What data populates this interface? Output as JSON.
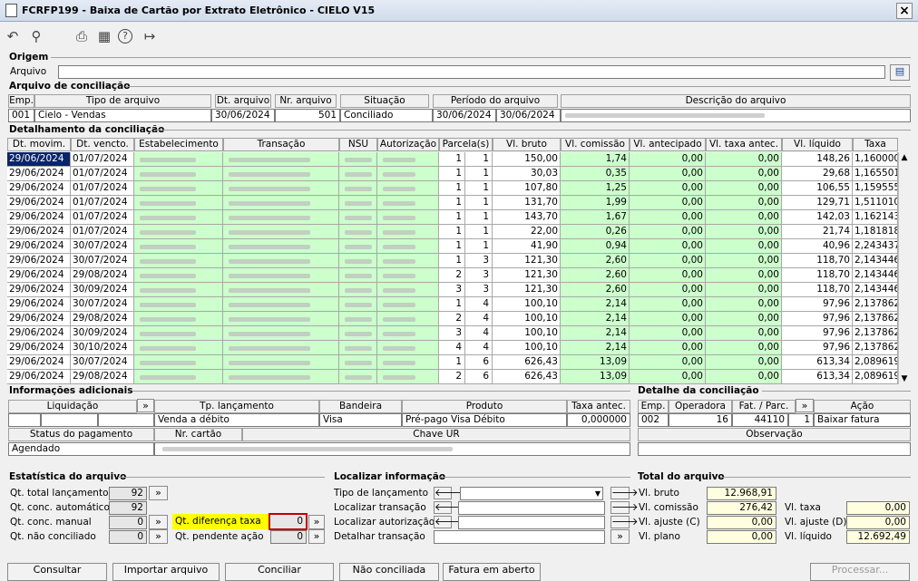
{
  "window": {
    "title": "FCRFP199 - Baixa de Cartão por Extrato Eletrônico - CIELO V15",
    "close": "×"
  },
  "toolbar": {
    "undo": "↶",
    "search": "⚲",
    "print": "⎙",
    "calendar": "▦",
    "help": "?",
    "exit": "↦"
  },
  "origem": {
    "section": "Origem",
    "arquivo_label": "Arquivo",
    "arquivo_value": ""
  },
  "conciliacao": {
    "section": "Arquivo de conciliação",
    "headers": [
      "Emp.",
      "Tipo de arquivo",
      "Dt. arquivo",
      "Nr. arquivo",
      "Situação",
      "Período do arquivo",
      "Descrição do arquivo"
    ],
    "row": {
      "emp": "001",
      "tipo": "Cielo - Vendas",
      "dt": "30/06/2024",
      "nr": "501",
      "situacao": "Conciliado",
      "periodo_ini": "30/06/2024",
      "periodo_fim": "30/06/2024"
    }
  },
  "detalhamento": {
    "section": "Detalhamento da conciliação",
    "headers": [
      "Dt. movim.",
      "Dt. vencto.",
      "Estabelecimento",
      "Transação",
      "NSU",
      "Autorização",
      "Parcela(s)",
      "Vl. bruto",
      "Vl. comissão",
      "Vl. antecipado",
      "Vl. taxa antec.",
      "Vl. líquido",
      "Taxa"
    ],
    "rows": [
      [
        "29/06/2024",
        "01/07/2024",
        "1",
        "1",
        "150,00",
        "1,74",
        "0,00",
        "0,00",
        "148,26",
        "1,160000"
      ],
      [
        "29/06/2024",
        "01/07/2024",
        "1",
        "1",
        "30,03",
        "0,35",
        "0,00",
        "0,00",
        "29,68",
        "1,165501"
      ],
      [
        "29/06/2024",
        "01/07/2024",
        "1",
        "1",
        "107,80",
        "1,25",
        "0,00",
        "0,00",
        "106,55",
        "1,159555"
      ],
      [
        "29/06/2024",
        "01/07/2024",
        "1",
        "1",
        "131,70",
        "1,99",
        "0,00",
        "0,00",
        "129,71",
        "1,511010"
      ],
      [
        "29/06/2024",
        "01/07/2024",
        "1",
        "1",
        "143,70",
        "1,67",
        "0,00",
        "0,00",
        "142,03",
        "1,162143"
      ],
      [
        "29/06/2024",
        "01/07/2024",
        "1",
        "1",
        "22,00",
        "0,26",
        "0,00",
        "0,00",
        "21,74",
        "1,181818"
      ],
      [
        "29/06/2024",
        "30/07/2024",
        "1",
        "1",
        "41,90",
        "0,94",
        "0,00",
        "0,00",
        "40,96",
        "2,243437"
      ],
      [
        "29/06/2024",
        "30/07/2024",
        "1",
        "3",
        "121,30",
        "2,60",
        "0,00",
        "0,00",
        "118,70",
        "2,143446"
      ],
      [
        "29/06/2024",
        "29/08/2024",
        "2",
        "3",
        "121,30",
        "2,60",
        "0,00",
        "0,00",
        "118,70",
        "2,143446"
      ],
      [
        "29/06/2024",
        "30/09/2024",
        "3",
        "3",
        "121,30",
        "2,60",
        "0,00",
        "0,00",
        "118,70",
        "2,143446"
      ],
      [
        "29/06/2024",
        "30/07/2024",
        "1",
        "4",
        "100,10",
        "2,14",
        "0,00",
        "0,00",
        "97,96",
        "2,137862"
      ],
      [
        "29/06/2024",
        "29/08/2024",
        "2",
        "4",
        "100,10",
        "2,14",
        "0,00",
        "0,00",
        "97,96",
        "2,137862"
      ],
      [
        "29/06/2024",
        "30/09/2024",
        "3",
        "4",
        "100,10",
        "2,14",
        "0,00",
        "0,00",
        "97,96",
        "2,137862"
      ],
      [
        "29/06/2024",
        "30/10/2024",
        "4",
        "4",
        "100,10",
        "2,14",
        "0,00",
        "0,00",
        "97,96",
        "2,137862"
      ],
      [
        "29/06/2024",
        "30/07/2024",
        "1",
        "6",
        "626,43",
        "13,09",
        "0,00",
        "0,00",
        "613,34",
        "2,089619"
      ],
      [
        "29/06/2024",
        "29/08/2024",
        "2",
        "6",
        "626,43",
        "13,09",
        "0,00",
        "0,00",
        "613,34",
        "2,089619"
      ]
    ]
  },
  "info": {
    "section": "Informações adicionais",
    "liquidacao": "Liquidação",
    "tp_lanc": "Tp. lançamento",
    "bandeira": "Bandeira",
    "produto": "Produto",
    "taxa_antec": "Taxa antec.",
    "tp_lanc_val": "Venda a débito",
    "bandeira_val": "Visa",
    "produto_val": "Pré-pago Visa Débito",
    "taxa_antec_val": "0,000000",
    "status_pag": "Status do pagamento",
    "nr_cartao": "Nr. cartão",
    "chave_ur": "Chave UR",
    "status_val": "Agendado",
    "arrow": "»"
  },
  "detalhe": {
    "section": "Detalhe da conciliação",
    "emp": "Emp.",
    "operadora": "Operadora",
    "fat": "Fat. / Parc.",
    "acao": "Ação",
    "emp_val": "002",
    "operadora_val": "16",
    "fat_val": "44110",
    "parc_val": "1",
    "acao_val": "Baixar fatura",
    "observacao": "Observação"
  },
  "estat": {
    "section": "Estatística do arquivo",
    "qt_total": "Qt. total lançamentos",
    "qt_total_val": "92",
    "qt_auto": "Qt. conc. automático",
    "qt_auto_val": "92",
    "qt_manual": "Qt. conc. manual",
    "qt_manual_val": "0",
    "qt_nao": "Qt. não conciliado",
    "qt_nao_val": "0",
    "qt_dif": "Qt. diferença taxa",
    "qt_dif_val": "0",
    "qt_pend": "Qt. pendente ação",
    "qt_pend_val": "0"
  },
  "localizar": {
    "section": "Localizar informação",
    "tipo": "Tipo de lançamento",
    "transacao": "Localizar transação",
    "autorizacao": "Localizar autorização",
    "detalhar": "Detalhar transação"
  },
  "total": {
    "section": "Total do arquivo",
    "bruto": "Vl. bruto",
    "bruto_val": "12.968,91",
    "comissao": "Vl. comissão",
    "comissao_val": "276,42",
    "ajuste_c": "Vl. ajuste (C)",
    "ajuste_c_val": "0,00",
    "plano": "Vl. plano",
    "plano_val": "0,00",
    "taxa": "Vl. taxa",
    "taxa_val": "0,00",
    "ajuste_d": "Vl. ajuste (D)",
    "ajuste_d_val": "0,00",
    "liquido": "Vl. líquido",
    "liquido_val": "12.692,49"
  },
  "buttons": {
    "consultar": "Consultar",
    "importar": "Importar arquivo",
    "conciliar": "Conciliar",
    "nao_conciliada": "Não conciliada",
    "fatura": "Fatura em aberto",
    "processar": "Processar..."
  },
  "colors": {
    "green_row": "#ccffcc",
    "highlight": "#ffff00",
    "selected": "#0a246a"
  }
}
